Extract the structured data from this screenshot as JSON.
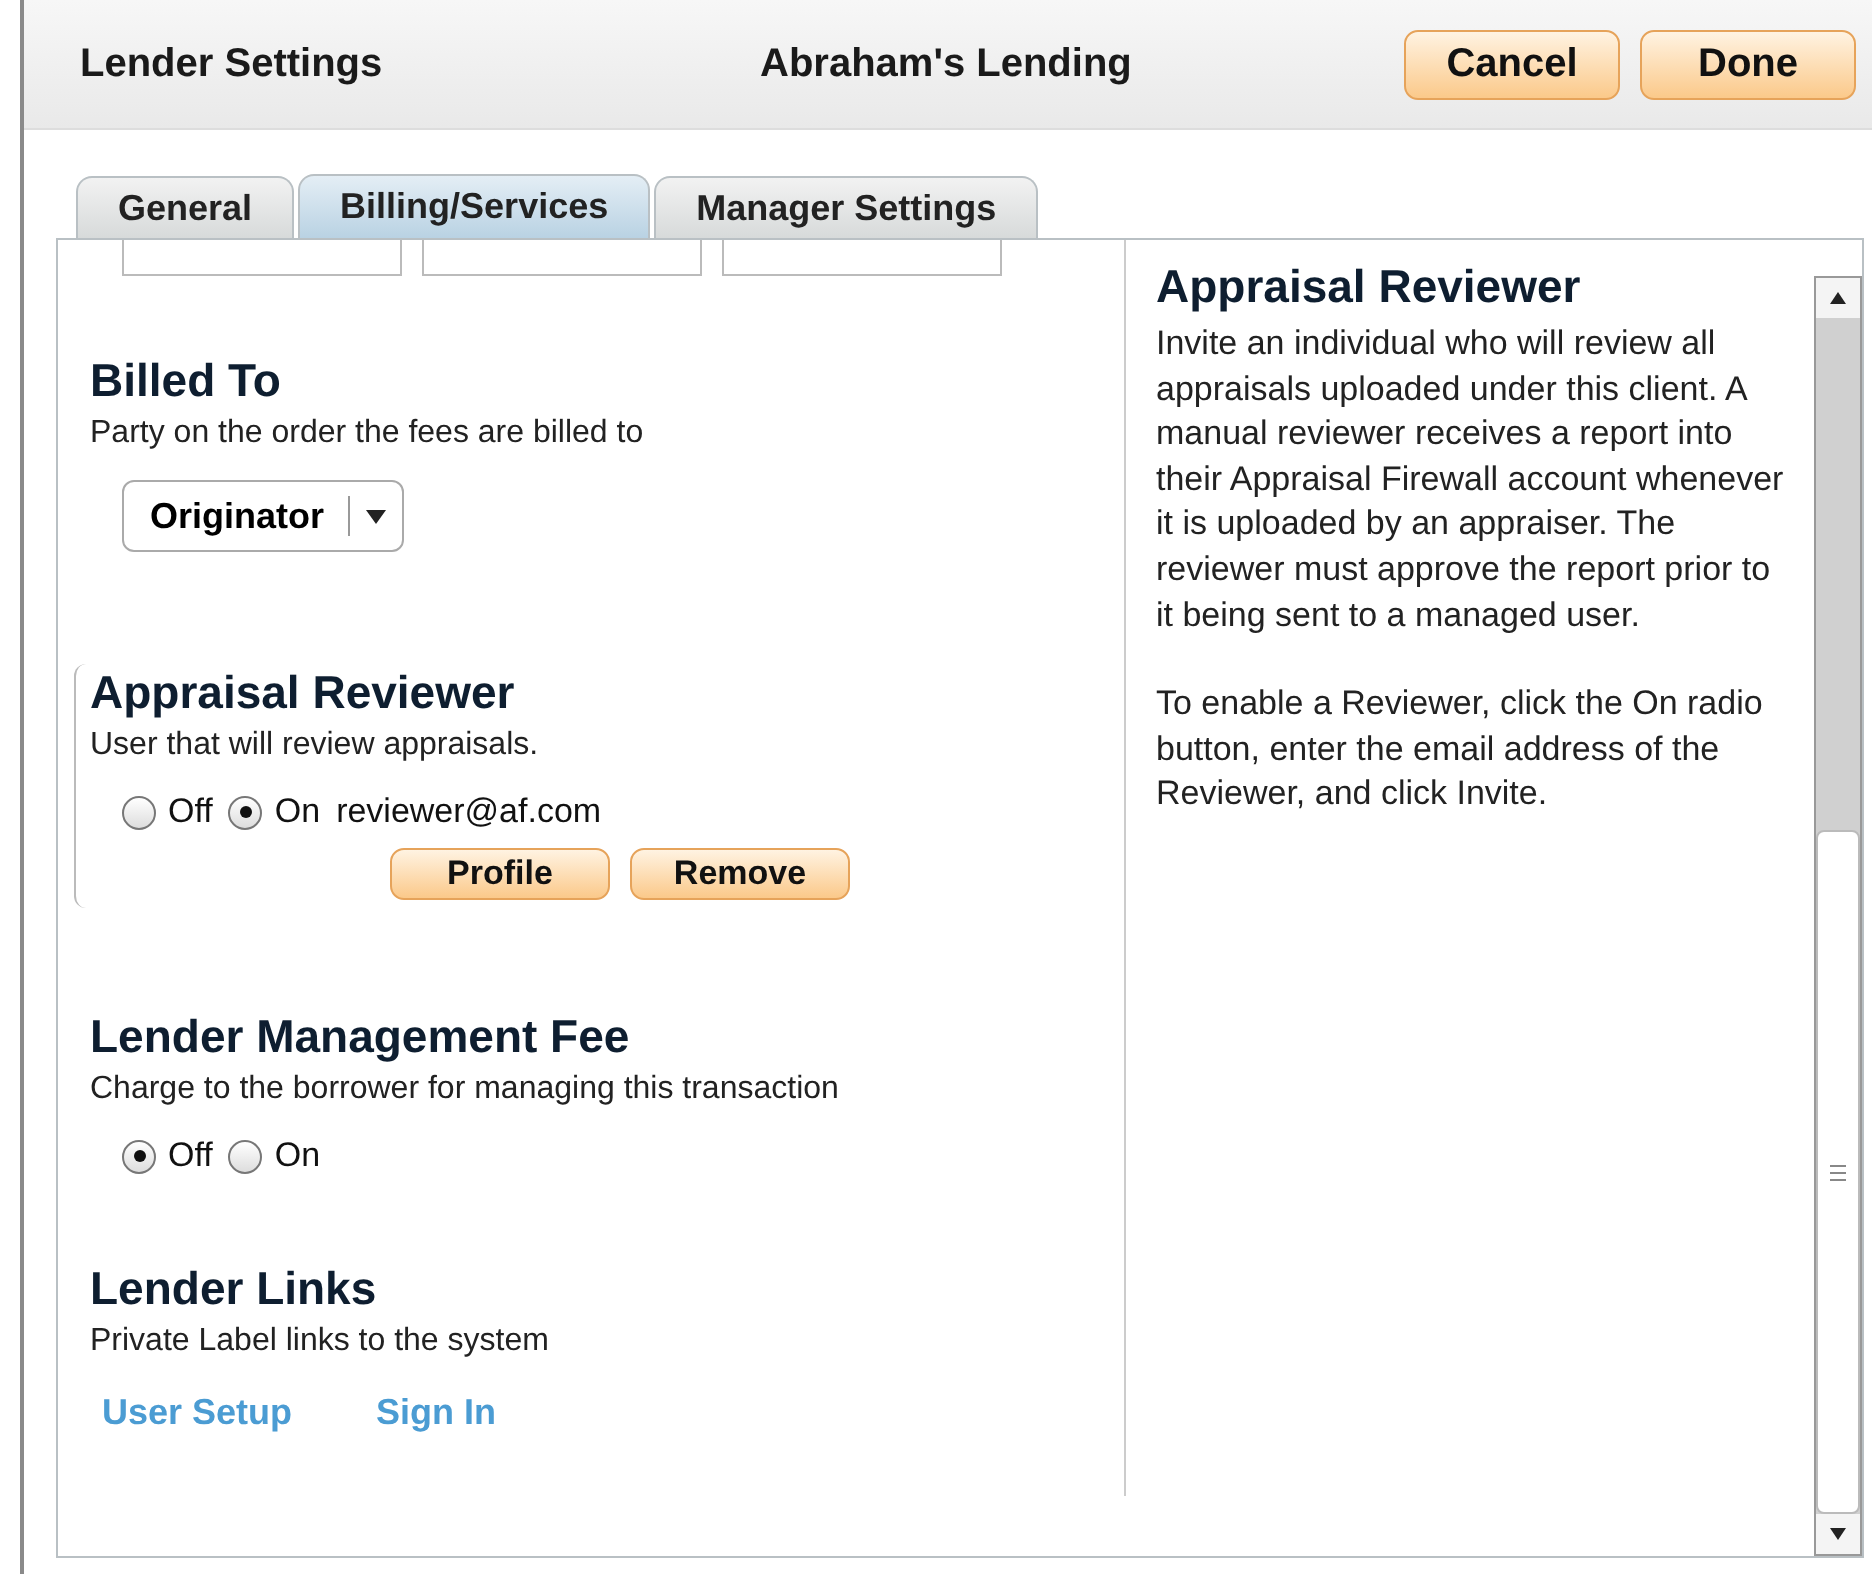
{
  "header": {
    "title": "Lender Settings",
    "client": "Abraham's Lending",
    "buttons": [
      "Cancel",
      "Done"
    ]
  },
  "tabs": [
    {
      "label": "General",
      "selected": false
    },
    {
      "label": "Billing/Services",
      "selected": true
    },
    {
      "label": "Manager Settings",
      "selected": false
    }
  ],
  "top_fields": [
    {
      "kind": "field"
    },
    {
      "kind": "field"
    },
    {
      "kind": "field"
    }
  ],
  "sections": [
    {
      "kind": "select",
      "title": "Billed To",
      "description": "Party on the order the fees are billed to",
      "value": "Originator"
    },
    {
      "kind": "reviewer",
      "title": "Appraisal Reviewer",
      "description": "User that will review appraisals.",
      "options": [
        {
          "label": "Off",
          "selected": false
        },
        {
          "label": "On",
          "selected": true
        }
      ],
      "email": "reviewer@af.com",
      "buttons": [
        "Profile",
        "Remove"
      ]
    },
    {
      "kind": "radio",
      "title": "Lender Management Fee",
      "description": "Charge to the borrower for managing this transaction",
      "options": [
        {
          "label": "Off",
          "selected": true
        },
        {
          "label": "On",
          "selected": false
        }
      ]
    },
    {
      "kind": "links",
      "title": "Lender Links",
      "description": "Private Label links to the system",
      "links": [
        "User Setup",
        "Sign In"
      ]
    }
  ],
  "help": {
    "title": "Appraisal Reviewer",
    "paragraphs": [
      "Invite an individual who will review all appraisals uploaded under this client. A manual reviewer receives a report into their Appraisal Firewall account whenever it is uploaded by an appraiser. The reviewer must approve the report prior to it being sent to a managed user.",
      "To enable a Reviewer, click the On radio button, enter the email address of the Reviewer, and click Invite."
    ]
  }
}
